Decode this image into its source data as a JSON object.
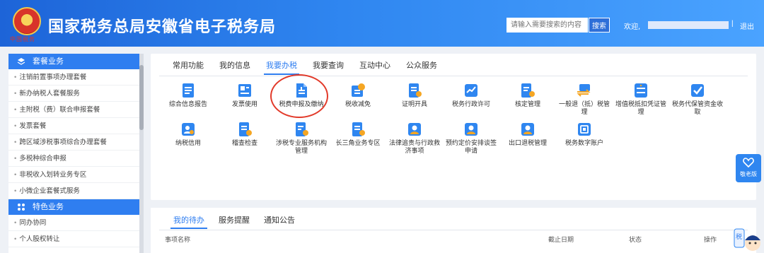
{
  "header": {
    "emblem_text": "中国税务",
    "title": "国家税务总局安徽省电子税务局",
    "search_placeholder": "请输入需要搜索的内容",
    "search_button": "搜索",
    "welcome": "欢迎,",
    "separator": "|",
    "logout": "退出"
  },
  "sidebar": {
    "section1": "套餐业务",
    "items1": [
      "注销前置事项办理套餐",
      "新办纳税人套餐服务",
      "主附税（费）联合申报套餐",
      "发票套餐",
      "跨区域涉税事项综合办理套餐",
      "多税种综合申报",
      "非税收入划转业务专区",
      "小微企业套餐式服务"
    ],
    "section2": "特色业务",
    "items2": [
      "同办协同",
      "个人股权转让"
    ]
  },
  "tabs": [
    "常用功能",
    "我的信息",
    "我要办税",
    "我要查询",
    "互动中心",
    "公众服务"
  ],
  "services_row1": [
    "综合信息报告",
    "发票使用",
    "税费申报及缴纳",
    "税收减免",
    "证明开具",
    "税务行政许可",
    "核定管理",
    "一般退（抵）税管理",
    "增值税抵扣凭证管理",
    "税务代保管资金收取"
  ],
  "services_row2": [
    "纳税信用",
    "稽查检查",
    "涉税专业服务机构管理",
    "长三角业务专区",
    "法律追责与行政救济事项",
    "预约定价安排谈签申请",
    "出口退税管理",
    "税务数字账户"
  ],
  "todo": {
    "tabs": [
      "我的待办",
      "服务提醒",
      "通知公告"
    ],
    "columns": [
      "事项名称",
      "截止日期",
      "状态",
      "操作"
    ]
  },
  "floating": {
    "elder_label": "敬老版",
    "mascot_text": "税"
  },
  "colors": {
    "primary": "#2f7ef0",
    "header_start": "#1d64d8",
    "highlight_circle": "#e23a2a"
  }
}
